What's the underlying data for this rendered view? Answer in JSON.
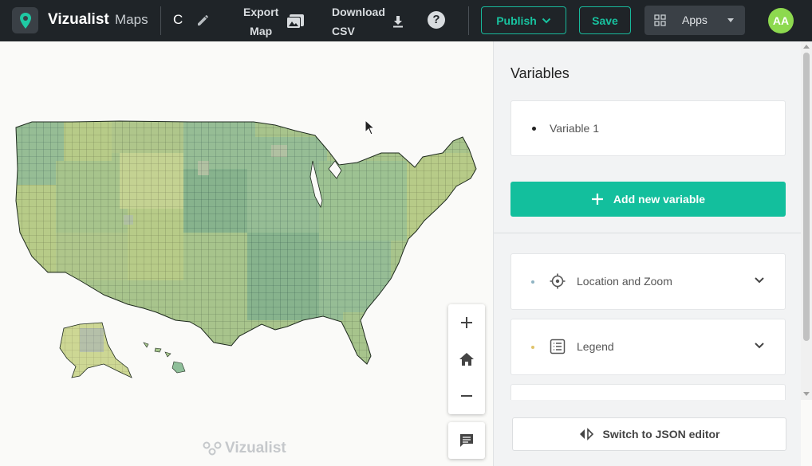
{
  "header": {
    "brand": "Vizualist",
    "brand_sub": "Maps",
    "map_title": "C",
    "export_map_line1": "Export",
    "export_map_line2": "Map",
    "download_csv_line1": "Download",
    "download_csv_line2": "CSV",
    "help_label": "?",
    "publish_label": "Publish",
    "save_label": "Save",
    "apps_label": "Apps",
    "avatar_initials": "AA"
  },
  "map": {
    "watermark": "Vizualist",
    "palette": [
      "#7fb5a0",
      "#a5c48c",
      "#c9d484",
      "#e6e39a",
      "#5f9f8e",
      "#b8c98a",
      "#bdbdbd"
    ]
  },
  "panel": {
    "title": "Variables",
    "variables": [
      "Variable 1"
    ],
    "add_variable_label": "Add new variable",
    "sections": [
      {
        "label": "Location and Zoom",
        "icon": "crosshair-icon",
        "dot_color": "#8fb3c2"
      },
      {
        "label": "Legend",
        "icon": "list-icon",
        "dot_color": "#e0c36a"
      }
    ],
    "json_editor_label": "Switch to JSON editor"
  },
  "colors": {
    "accent": "#13bf9d",
    "topbar": "#1f2428",
    "avatar": "#8dd94f"
  }
}
